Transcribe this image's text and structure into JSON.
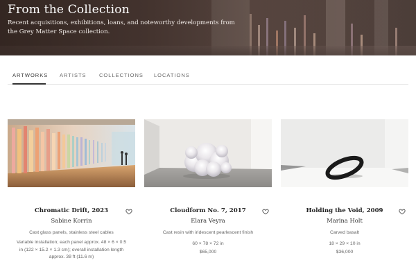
{
  "hero": {
    "title": "From the Collection",
    "subtitle": "Recent acquisitions, exhibitions, loans, and noteworthy developments from the Grey Matter Space collection."
  },
  "tabs": [
    {
      "label": "ARTWORKS",
      "active": true
    },
    {
      "label": "ARTISTS",
      "active": false
    },
    {
      "label": "COLLECTIONS",
      "active": false
    },
    {
      "label": "LOCATIONS",
      "active": false
    }
  ],
  "artworks": [
    {
      "title": "Chromatic Drift, 2023",
      "artist": "Sabine Korrin",
      "medium": "Cast glass panels, stainless steel cables",
      "dimensions": "Variable installation; each panel approx. 48 × 6 × 0.5 in (122 × 15.2 × 1.3 cm); overall installation length approx. 38 ft (11.6 m)",
      "price": "",
      "image_icon": "glass-installation-image"
    },
    {
      "title": "Cloudform No. 7, 2017",
      "artist": "Elara Veyra",
      "medium": "Cast resin with iridescent pearlescent finish",
      "dimensions": "60 × 78 × 72 in",
      "price": "$65,000",
      "image_icon": "pearl-cloud-sculpture-image"
    },
    {
      "title": "Holding the Void, 2009",
      "artist": "Marina Holt",
      "medium": "Carved basalt",
      "dimensions": "18 × 29 × 10 in",
      "price": "$36,000",
      "image_icon": "basalt-ring-sculpture-image"
    }
  ],
  "icons": {
    "favorite": "heart-outline-icon"
  }
}
